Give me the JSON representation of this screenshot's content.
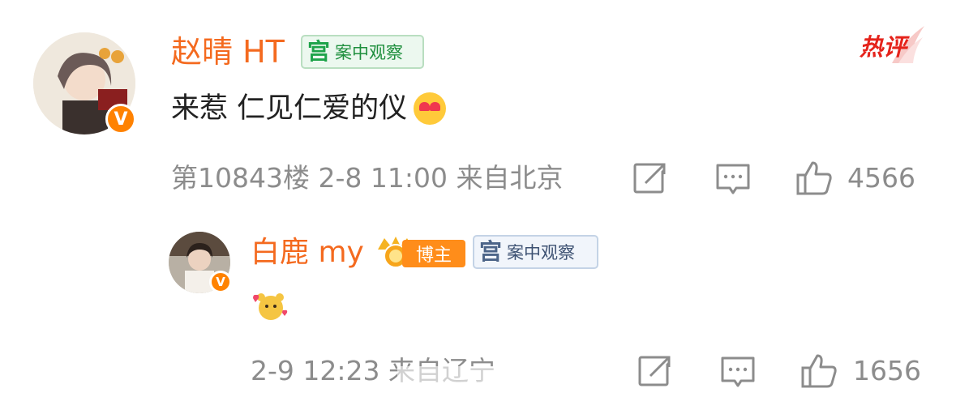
{
  "comment": {
    "user": {
      "name": "赵晴 HT",
      "badge_text": "案中观察",
      "badge_icon": "宫",
      "verified": "V"
    },
    "content": "来惹 仁见仁爱的仪",
    "emoji": "heart-eyes-face",
    "hot_label": "热评",
    "meta": {
      "floor": "第10843楼",
      "time": "2-8 11:00",
      "location": "来自北京"
    },
    "likes": "4566"
  },
  "reply": {
    "user": {
      "name": "白鹿 my",
      "role_badge": "博主",
      "badge_text": "案中观察",
      "badge_icon": "宫",
      "verified": "V"
    },
    "emoji": "hamster-hearts",
    "meta": {
      "time": "2-9 12:23",
      "location": "来自辽宁"
    },
    "likes": "1656"
  },
  "colors": {
    "name": "#f46a1f",
    "meta": "#8c8c8c",
    "hot": "#e5231b",
    "badge_green": "#1ea34a",
    "orange": "#ff8200"
  }
}
